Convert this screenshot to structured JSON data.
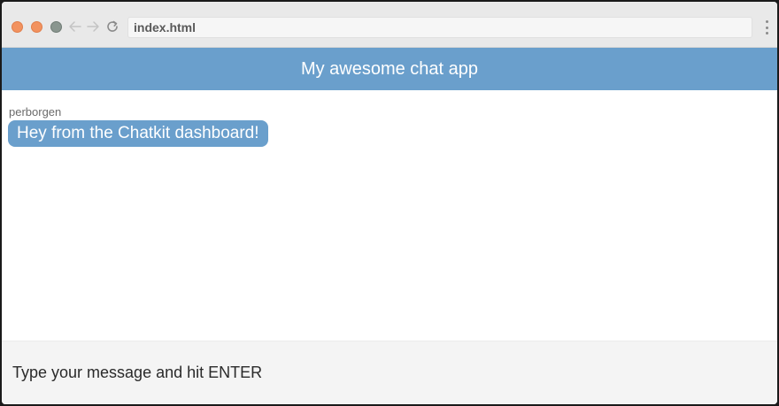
{
  "browser": {
    "address": "index.html"
  },
  "app": {
    "title": "My awesome chat app"
  },
  "messages": [
    {
      "username": "perborgen",
      "text": "Hey from the Chatkit dashboard!"
    }
  ],
  "send_form": {
    "placeholder": "Type your message and hit ENTER",
    "value": ""
  },
  "colors": {
    "accent": "#6a9fcc",
    "traffic_light": "#f2925f",
    "input_background": "#f4f4f4"
  }
}
